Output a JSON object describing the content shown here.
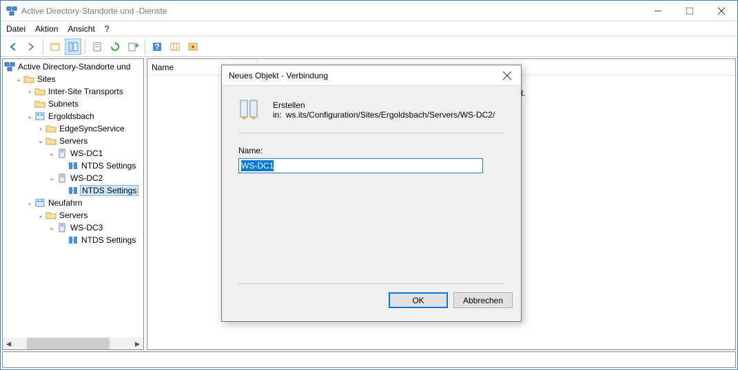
{
  "titlebar": {
    "title": "Active Directory-Standorte und -Dienste"
  },
  "menu": {
    "file": "Datei",
    "action": "Aktion",
    "view": "Ansicht",
    "help": "?"
  },
  "toolbar": {
    "back": "back",
    "forward": "forward"
  },
  "tree": {
    "root": "Active Directory-Standorte und",
    "sites": "Sites",
    "ist": "Inter-Site Transports",
    "subnets": "Subnets",
    "site1": "Ergoldsbach",
    "edgesync": "EdgeSyncService",
    "servers1": "Servers",
    "dc1": "WS-DC1",
    "ntds1": "NTDS Settings",
    "dc2": "WS-DC2",
    "ntds2": "NTDS Settings",
    "site2": "Neufahrn",
    "servers2": "Servers",
    "dc3": "WS-DC3",
    "ntds3": "NTDS Settings"
  },
  "list": {
    "col_name": "Name",
    "empty_suffix": "zeigt."
  },
  "dialog": {
    "title": "Neues Objekt - Verbindung",
    "create_in_label": "Erstellen in:",
    "create_in_path": "ws.its/Configuration/Sites/Ergoldsbach/Servers/WS-DC2/",
    "name_label": "Name:",
    "name_value": "WS-DC1",
    "ok": "OK",
    "cancel": "Abbrechen"
  }
}
